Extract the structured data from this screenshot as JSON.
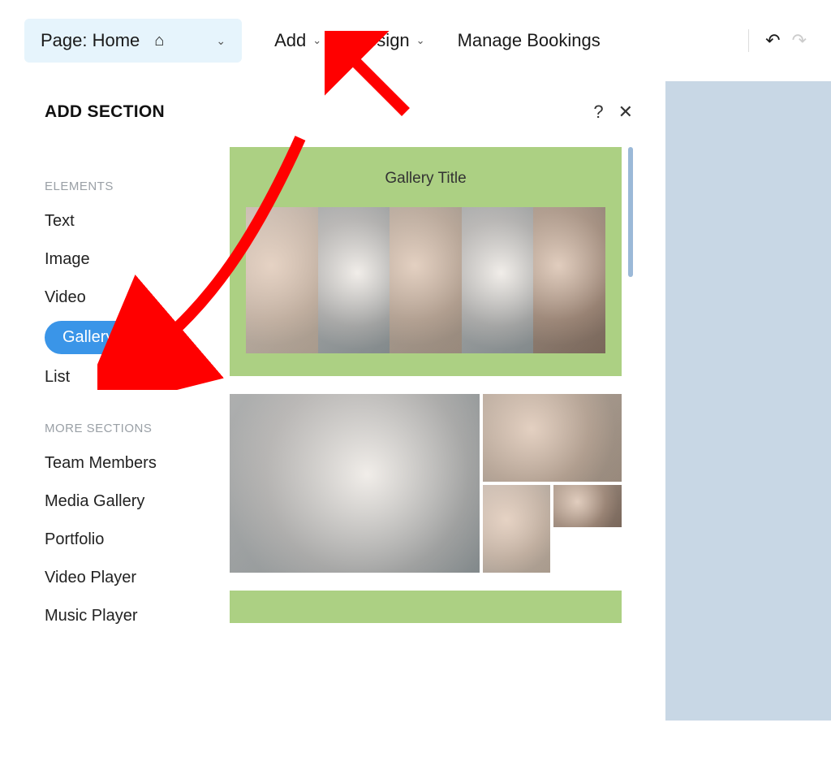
{
  "toolbar": {
    "page_label": "Page: Home",
    "add_label": "Add",
    "design_label": "Design",
    "bookings_label": "Manage Bookings"
  },
  "panel": {
    "title": "ADD SECTION"
  },
  "sidebar": {
    "category_elements": "ELEMENTS",
    "category_more": "MORE SECTIONS",
    "elements": [
      {
        "label": "Text"
      },
      {
        "label": "Image"
      },
      {
        "label": "Video"
      },
      {
        "label": "Gallery",
        "active": true
      },
      {
        "label": "List"
      }
    ],
    "more": [
      {
        "label": "Team Members"
      },
      {
        "label": "Media Gallery"
      },
      {
        "label": "Portfolio"
      },
      {
        "label": "Video Player"
      },
      {
        "label": "Music Player"
      }
    ]
  },
  "preview": {
    "gallery_title": "Gallery Title"
  }
}
